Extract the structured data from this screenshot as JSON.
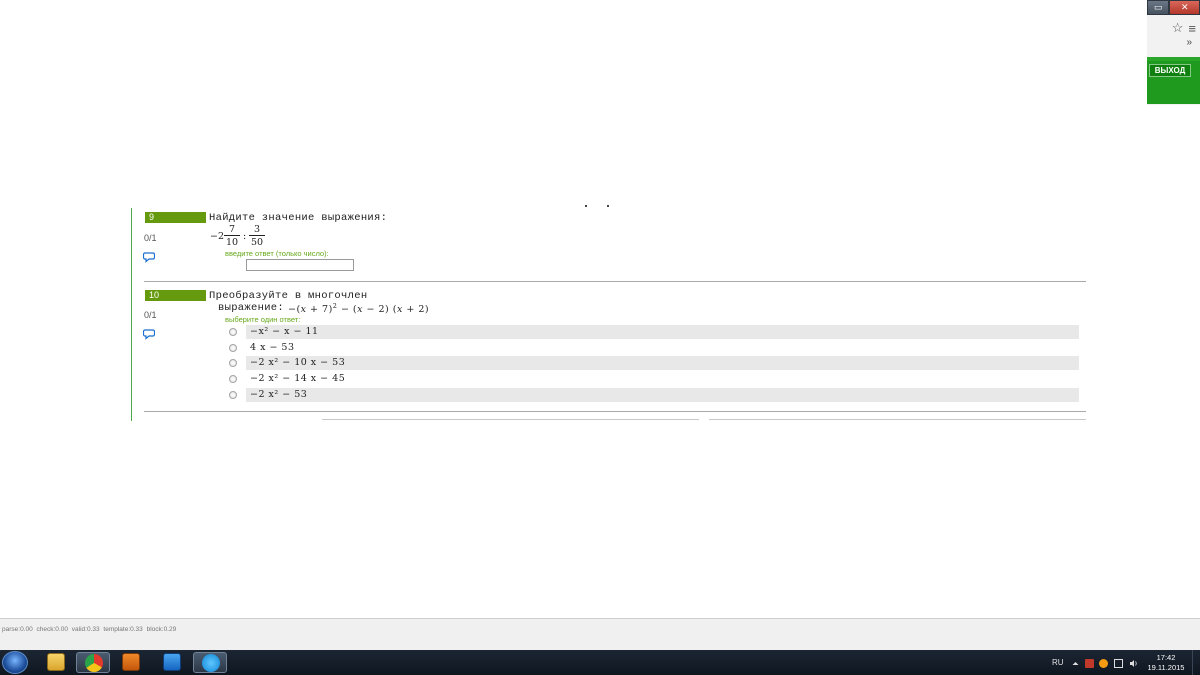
{
  "chrome": {
    "exit_label": "ВЫХОД",
    "more_glyph": "»",
    "star_glyph": "☆",
    "menu_glyph": "≡",
    "minimize_glyph": "▭",
    "close_glyph": "✕"
  },
  "questions": [
    {
      "number": "9",
      "score": "0/1",
      "title": "Найдите значение выражения:",
      "expression": {
        "prefix": "−2",
        "frac1": {
          "num": "7",
          "den": "10"
        },
        "operator": ":",
        "frac2": {
          "num": "3",
          "den": "50"
        }
      },
      "hint": "введите ответ (только число):",
      "answer_value": ""
    },
    {
      "number": "10",
      "score": "0/1",
      "title_line1": "Преобразуйте в многочлен",
      "title_line2": "выражение:",
      "hint": "выберите один ответ:",
      "options": [
        "−x² − x − 11",
        "4 x − 53",
        "−2 x² − 10 x − 53",
        "−2 x² − 14 x − 45",
        "−2 x² − 53"
      ]
    }
  ],
  "debug_text": "parse:0.00   check:0.00   valid:0.33   template:0.33   block:0.29",
  "taskbar": {
    "lang": "RU",
    "time": "17:42",
    "date": "19.11.2015",
    "icons": [
      "windows-explorer-icon",
      "chrome-icon",
      "media-player-icon",
      "zoom-app-icon",
      "skype-icon"
    ]
  },
  "colors": {
    "question_number_bg": "#669a0e",
    "hint_green": "#66a81a",
    "exit_green": "#1f9a1f",
    "vertical_rule": "#4ea84e"
  }
}
